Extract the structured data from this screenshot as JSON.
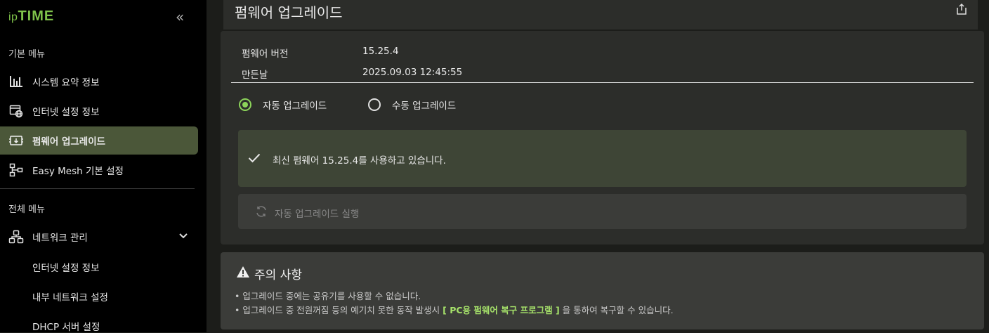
{
  "logo": {
    "prefix": "ip",
    "name": "TIME"
  },
  "sidebar": {
    "basic_menu_title": "기본 메뉴",
    "basic_items": [
      {
        "label": "시스템 요약 정보",
        "icon": "bar-chart-icon"
      },
      {
        "label": "인터넷 설정 정보",
        "icon": "internet-settings-icon"
      },
      {
        "label": "펌웨어 업그레이드",
        "icon": "firmware-icon"
      },
      {
        "label": "Easy Mesh 기본 설정",
        "icon": "mesh-icon"
      }
    ],
    "all_menu_title": "전체 메뉴",
    "network_group": {
      "label": "네트워크 관리",
      "icon": "network-icon"
    },
    "network_sub_items": [
      "인터넷 설정 정보",
      "내부 네트워크 설정",
      "DHCP 서버 설정"
    ]
  },
  "page": {
    "title": "펌웨어 업그레이드"
  },
  "firmware": {
    "version_label": "펌웨어 버전",
    "version_value": "15.25.4",
    "built_label": "만든날",
    "built_value": "2025.09.03 12:45:55"
  },
  "upgrade_mode": {
    "auto_label": "자동 업그레이드",
    "manual_label": "수동 업그레이드",
    "selected": "auto"
  },
  "status": {
    "message": "최신 펌웨어 15.25.4를 사용하고 있습니다."
  },
  "run_button": {
    "label": "자동 업그레이드 실행"
  },
  "notice": {
    "title": "주의 사항",
    "line1": "• 업그레이드 중에는 공유기를 사용할 수 없습니다.",
    "line2_pre": "• 업그레이드 중 전원꺼짐 등의 예기치 못한 동작 발생시",
    "line2_link": "[ PC용 펌웨어 복구 프로그램 ]",
    "line2_post": "을 통하여 복구할 수  있습니다."
  },
  "colors": {
    "accent": "#8cd35a",
    "active_bg": "#4b5739",
    "logo": "#7fc24a"
  }
}
